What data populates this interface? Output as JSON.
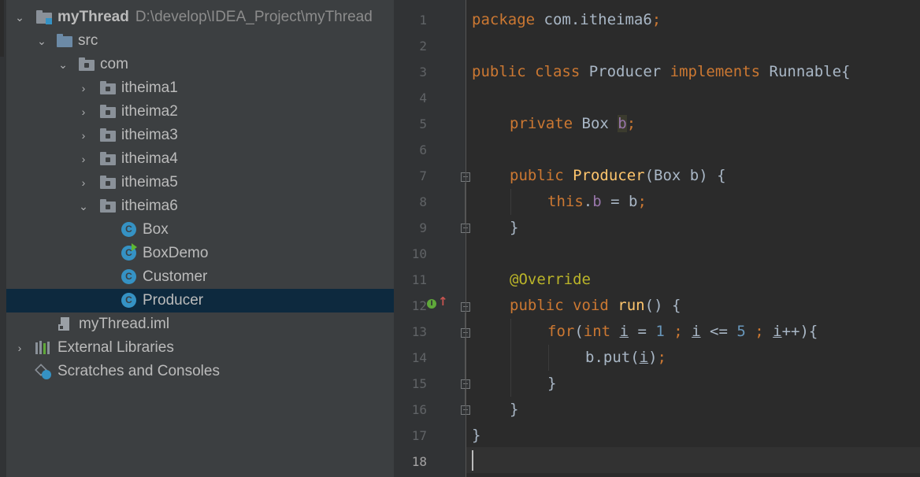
{
  "project": {
    "name": "myThread",
    "path": "D:\\develop\\IDEA_Project\\myThread",
    "src": "src",
    "com": "com",
    "packages": [
      "itheima1",
      "itheima2",
      "itheima3",
      "itheima4",
      "itheima5",
      "itheima6"
    ],
    "classes": [
      "Box",
      "BoxDemo",
      "Customer",
      "Producer"
    ],
    "class_icon_letter": "C",
    "iml_file": "myThread.iml",
    "external_libraries": "External Libraries",
    "scratches": "Scratches and Consoles"
  },
  "editor": {
    "line_numbers": [
      "1",
      "2",
      "3",
      "4",
      "5",
      "6",
      "7",
      "8",
      "9",
      "10",
      "11",
      "12",
      "13",
      "14",
      "15",
      "16",
      "17",
      "18"
    ],
    "code": {
      "l1_kw": "package",
      "l1_rest": " com.itheima6",
      "l1_semi": ";",
      "l3_kw1": "public class",
      "l3_name": " Producer ",
      "l3_kw2": "implements",
      "l3_rest": " Runnable{",
      "l5_kw": "private",
      "l5_type": " Box ",
      "l5_var": "b",
      "l5_semi": ";",
      "l7_kw": "public",
      "l7_sp": " ",
      "l7_fn": "Producer",
      "l7_rest": "(Box b) {",
      "l8_kw": "this",
      "l8_dot": ".",
      "l8_fld": "b",
      "l8_rest": " = b",
      "l8_semi": ";",
      "l9": "}",
      "l11_ann": "@Override",
      "l12_kw": "public void",
      "l12_sp": " ",
      "l12_fn": "run",
      "l12_rest": "() {",
      "l13_kw1": "for",
      "l13_p": "(",
      "l13_kw2": "int",
      "l13_sp": " ",
      "l13_i1": "i",
      "l13_eq": " = ",
      "l13_n1": "1",
      "l13_s1": " ; ",
      "l13_i2": "i",
      "l13_le": " <= ",
      "l13_n2": "5",
      "l13_s2": " ; ",
      "l13_i3": "i",
      "l13_end": "++){",
      "l14_pre": "b.put(",
      "l14_i": "i",
      "l14_post": ")",
      "l14_semi": ";",
      "l15": "}",
      "l16": "}",
      "l17": "}"
    },
    "impl_icon_letter": "I",
    "impl_arrow": "↑"
  }
}
